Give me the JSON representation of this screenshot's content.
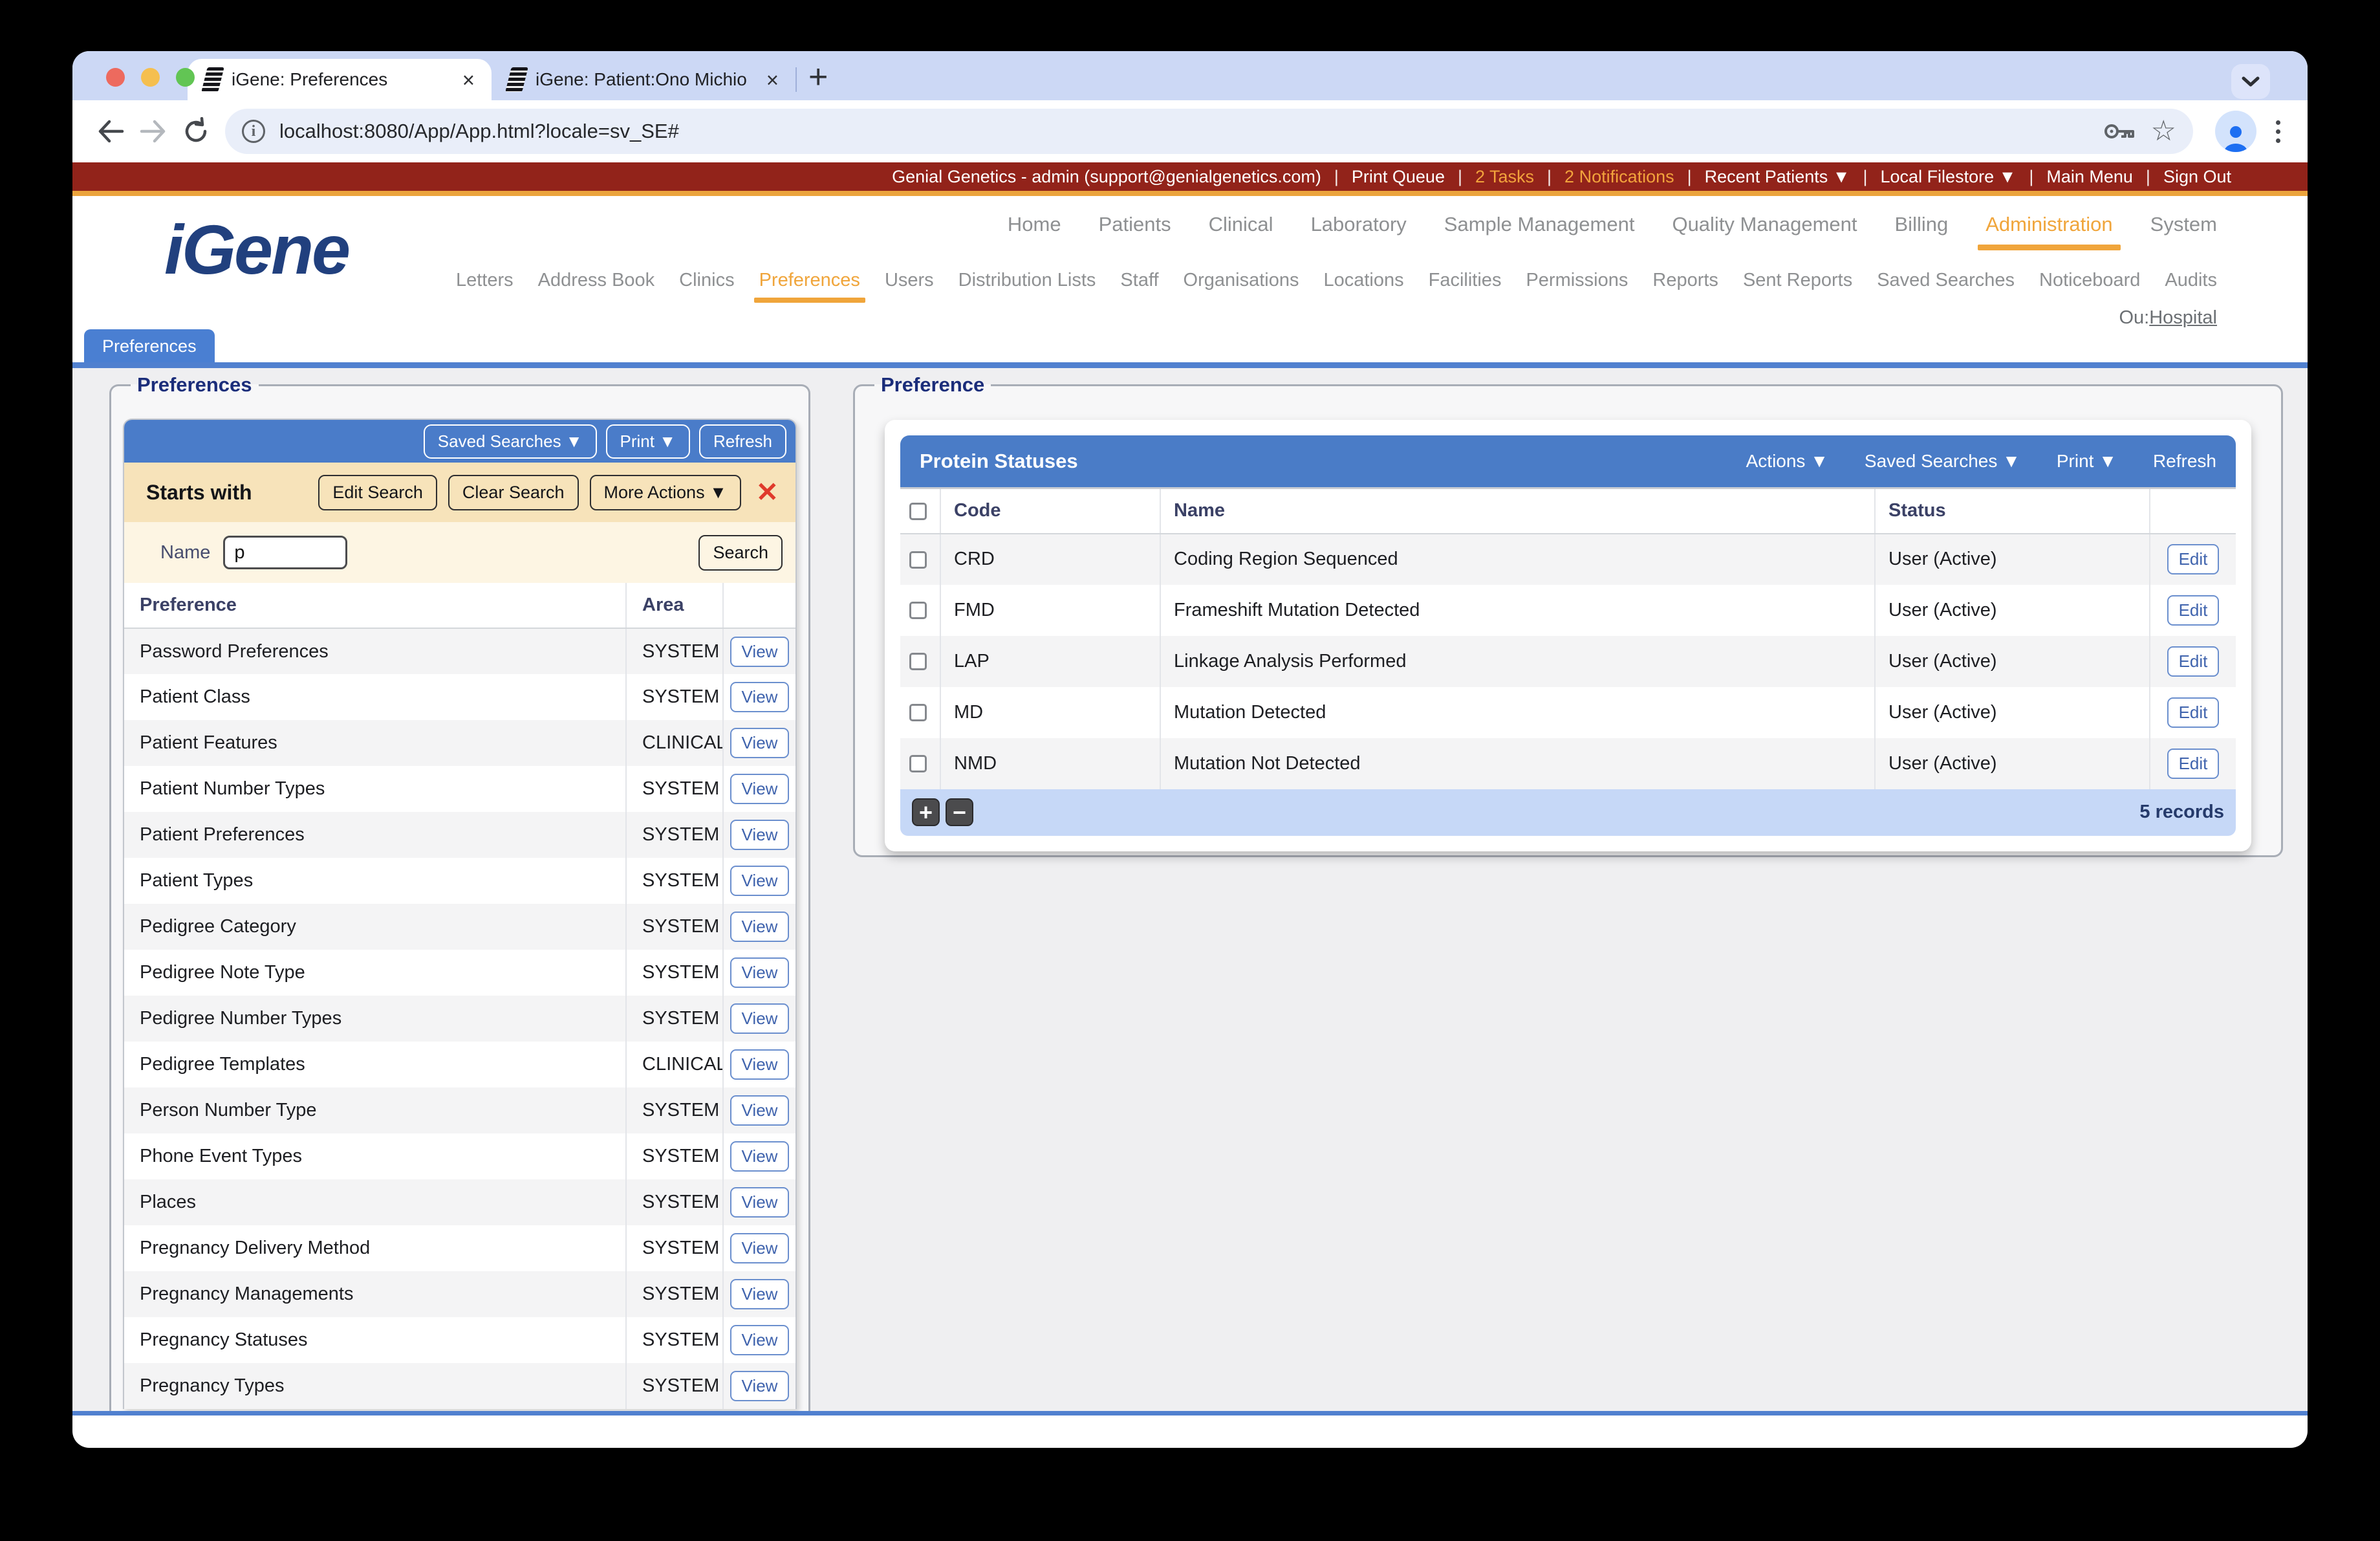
{
  "browser": {
    "tabs": [
      {
        "title": "iGene: Preferences",
        "active": true
      },
      {
        "title": "iGene: Patient:Ono Michio",
        "active": false
      }
    ],
    "new_tab_label": "+",
    "url": "localhost:8080/App/App.html?locale=sv_SE#"
  },
  "icons": {
    "traffic_lights": "close-minimize-zoom",
    "back": "left-arrow",
    "forward": "right-arrow",
    "reload": "circular-arrow",
    "site_info": "i",
    "password_key": "key",
    "bookmark_star": "☆",
    "profile_avatar": "person",
    "menu_kebab": "⋮",
    "tab_search_chevron": "v",
    "close_x": "×",
    "red_x": "✕",
    "add": "+",
    "remove": "−"
  },
  "topbar": {
    "items": [
      {
        "label": "Genial Genetics - admin (support@genialgenetics.com)"
      },
      {
        "label": "Print Queue"
      },
      {
        "label": "2 Tasks",
        "tone": "orange"
      },
      {
        "label": "2 Notifications",
        "tone": "orange"
      },
      {
        "label": "Recent Patients ▼"
      },
      {
        "label": "Local Filestore ▼"
      },
      {
        "label": "Main Menu"
      },
      {
        "label": "Sign Out"
      }
    ]
  },
  "header": {
    "logo": "iGene",
    "main_nav": [
      {
        "label": "Home"
      },
      {
        "label": "Patients"
      },
      {
        "label": "Clinical"
      },
      {
        "label": "Laboratory"
      },
      {
        "label": "Sample Management"
      },
      {
        "label": "Quality Management"
      },
      {
        "label": "Billing"
      },
      {
        "label": "Administration",
        "active": true
      },
      {
        "label": "System"
      }
    ],
    "sub_nav": [
      {
        "label": "Letters"
      },
      {
        "label": "Address Book"
      },
      {
        "label": "Clinics"
      },
      {
        "label": "Preferences",
        "active": true
      },
      {
        "label": "Users"
      },
      {
        "label": "Distribution Lists"
      },
      {
        "label": "Staff"
      },
      {
        "label": "Organisations"
      },
      {
        "label": "Locations"
      },
      {
        "label": "Facilities"
      },
      {
        "label": "Permissions"
      },
      {
        "label": "Reports"
      },
      {
        "label": "Sent Reports"
      },
      {
        "label": "Saved Searches"
      },
      {
        "label": "Noticeboard"
      },
      {
        "label": "Audits"
      }
    ],
    "ou_label": "Ou:",
    "ou_link": "Hospital"
  },
  "content_tab_label": "Preferences",
  "left_panel": {
    "legend": "Preferences",
    "toolbar_buttons": [
      "Saved Searches ▼",
      "Print ▼",
      "Refresh"
    ],
    "filter_title": "Starts with",
    "filter_buttons": [
      "Edit Search",
      "Clear Search",
      "More Actions ▼"
    ],
    "close_label": "✕",
    "name_label": "Name",
    "name_value": "p",
    "search_label": "Search",
    "columns": [
      "Preference",
      "Area"
    ],
    "rows": [
      {
        "name": "Password Preferences",
        "area": "SYSTEM",
        "action": "View"
      },
      {
        "name": "Patient Class",
        "area": "SYSTEM",
        "action": "View"
      },
      {
        "name": "Patient Features",
        "area": "CLINICAL",
        "action": "View"
      },
      {
        "name": "Patient Number Types",
        "area": "SYSTEM",
        "action": "View"
      },
      {
        "name": "Patient Preferences",
        "area": "SYSTEM",
        "action": "View"
      },
      {
        "name": "Patient Types",
        "area": "SYSTEM",
        "action": "View"
      },
      {
        "name": "Pedigree Category",
        "area": "SYSTEM",
        "action": "View"
      },
      {
        "name": "Pedigree Note Type",
        "area": "SYSTEM",
        "action": "View"
      },
      {
        "name": "Pedigree Number Types",
        "area": "SYSTEM",
        "action": "View"
      },
      {
        "name": "Pedigree Templates",
        "area": "CLINICAL",
        "action": "View"
      },
      {
        "name": "Person Number Type",
        "area": "SYSTEM",
        "action": "View"
      },
      {
        "name": "Phone Event Types",
        "area": "SYSTEM",
        "action": "View"
      },
      {
        "name": "Places",
        "area": "SYSTEM",
        "action": "View"
      },
      {
        "name": "Pregnancy Delivery Method",
        "area": "SYSTEM",
        "action": "View"
      },
      {
        "name": "Pregnancy Managements",
        "area": "SYSTEM",
        "action": "View"
      },
      {
        "name": "Pregnancy Statuses",
        "area": "SYSTEM",
        "action": "View"
      },
      {
        "name": "Pregnancy Types",
        "area": "SYSTEM",
        "action": "View"
      }
    ]
  },
  "right_panel": {
    "legend": "Preference",
    "title": "Protein Statuses",
    "actions": [
      "Actions ▼",
      "Saved Searches ▼",
      "Print ▼",
      "Refresh"
    ],
    "columns": [
      "Code",
      "Name",
      "Status"
    ],
    "rows": [
      {
        "code": "CRD",
        "name": "Coding Region Sequenced",
        "status": "User (Active)",
        "action": "Edit"
      },
      {
        "code": "FMD",
        "name": "Frameshift Mutation Detected",
        "status": "User (Active)",
        "action": "Edit"
      },
      {
        "code": "LAP",
        "name": "Linkage Analysis Performed",
        "status": "User (Active)",
        "action": "Edit"
      },
      {
        "code": "MD",
        "name": "Mutation Detected",
        "status": "User (Active)",
        "action": "Edit"
      },
      {
        "code": "NMD",
        "name": "Mutation Not Detected",
        "status": "User (Active)",
        "action": "Edit"
      }
    ],
    "footer": {
      "add_label": "+",
      "remove_label": "−",
      "records": "5 records"
    }
  }
}
